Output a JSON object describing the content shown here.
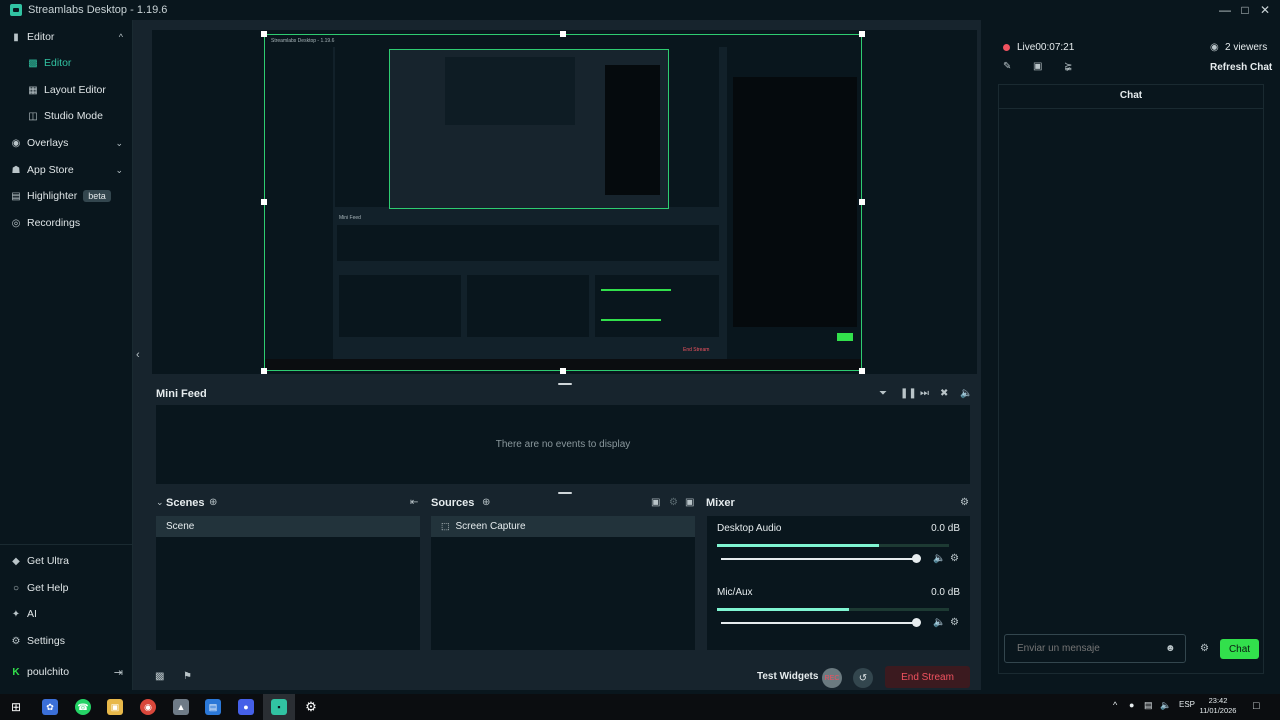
{
  "window": {
    "title": "Streamlabs Desktop - 1.19.6",
    "controls": [
      "minimize",
      "maximize",
      "close"
    ]
  },
  "sidebar": {
    "items": [
      {
        "label": "Editor",
        "icon": "editor-icon",
        "expanded": true
      },
      {
        "label": "Editor",
        "icon": "layers-icon",
        "active": true
      },
      {
        "label": "Layout Editor",
        "icon": "layout-icon"
      },
      {
        "label": "Studio Mode",
        "icon": "studio-mode-icon"
      },
      {
        "label": "Overlays",
        "icon": "overlays-icon",
        "expandable": true
      },
      {
        "label": "App Store",
        "icon": "store-icon",
        "expandable": true
      },
      {
        "label": "Highlighter",
        "icon": "highlighter-icon",
        "badge": "beta"
      },
      {
        "label": "Recordings",
        "icon": "recordings-icon"
      }
    ],
    "bottom_items": [
      {
        "label": "Get Ultra",
        "icon": "ultra-icon"
      },
      {
        "label": "Get Help",
        "icon": "help-icon"
      },
      {
        "label": "AI",
        "icon": "ai-icon"
      },
      {
        "label": "Settings",
        "icon": "gear-icon"
      },
      {
        "label": "poulchito",
        "icon": "kick-icon"
      }
    ]
  },
  "mini_feed": {
    "title": "Mini Feed",
    "empty_text": "There are no events to display"
  },
  "scenes": {
    "title": "Scenes",
    "items": [
      "Scene"
    ]
  },
  "sources": {
    "title": "Sources",
    "items": [
      "Screen Capture"
    ]
  },
  "mixer": {
    "title": "Mixer",
    "channels": [
      {
        "name": "Desktop Audio",
        "db": "0.0 dB",
        "level": 0.7,
        "volume": 1.0
      },
      {
        "name": "Mic/Aux",
        "db": "0.0 dB",
        "level": 0.57,
        "volume": 1.0
      }
    ]
  },
  "footer": {
    "test_widgets": "Test Widgets",
    "end_stream": "End Stream"
  },
  "chat": {
    "live_label": "Live",
    "live_time": "00:07:21",
    "viewers": "2 viewers",
    "refresh": "Refresh Chat",
    "title": "Chat",
    "input_placeholder": "Enviar un mensaje",
    "send_label": "Chat"
  },
  "taskbar": {
    "lang": "ESP",
    "time": "23:42",
    "date": "11/01/2026"
  },
  "colors": {
    "accent": "#31c3a2",
    "live": "#f0525f",
    "chat_button": "#32e04c",
    "preview_border": "#2ecc71"
  }
}
